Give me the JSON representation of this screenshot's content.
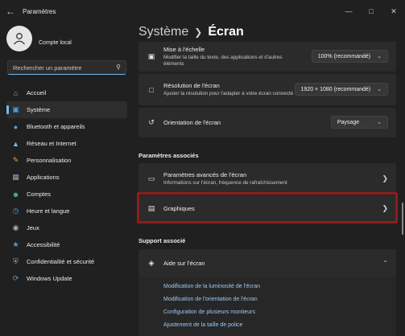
{
  "app": {
    "title": "Paramètres"
  },
  "profile": {
    "name": "Compte local"
  },
  "search": {
    "placeholder": "Rechercher un paramètre"
  },
  "sidebar": {
    "items": [
      {
        "label": "Accueil",
        "icon": "home-icon",
        "color": "#e8a23a"
      },
      {
        "label": "Système",
        "icon": "system-icon",
        "color": "#4aa3e8",
        "active": true
      },
      {
        "label": "Bluetooth et appareils",
        "icon": "bluetooth-icon",
        "color": "#4aa3e8"
      },
      {
        "label": "Réseau et Internet",
        "icon": "wifi-icon",
        "color": "#6fc3ef"
      },
      {
        "label": "Personnalisation",
        "icon": "brush-icon",
        "color": "#e8a23a"
      },
      {
        "label": "Applications",
        "icon": "apps-icon",
        "color": "#9aa4b2"
      },
      {
        "label": "Comptes",
        "icon": "accounts-icon",
        "color": "#3fbf8a"
      },
      {
        "label": "Heure et langue",
        "icon": "globe-clock-icon",
        "color": "#4aa3e8"
      },
      {
        "label": "Jeux",
        "icon": "gamepad-icon",
        "color": "#b0b0b0"
      },
      {
        "label": "Accessibilité",
        "icon": "accessibility-icon",
        "color": "#4aa3e8"
      },
      {
        "label": "Confidentialité et sécurité",
        "icon": "shield-icon",
        "color": "#9aa4b2"
      },
      {
        "label": "Windows Update",
        "icon": "update-icon",
        "color": "#4aa3e8"
      }
    ]
  },
  "breadcrumb": {
    "parent": "Système",
    "current": "Écran"
  },
  "settings": {
    "scale": {
      "title": "Mise à l'échelle",
      "desc": "Modifier la taille du texte, des applications et d'autres éléments",
      "value": "100% (recommandé)"
    },
    "resolution": {
      "title": "Résolution de l'écran",
      "desc": "Ajuster la résolution pour l'adapter à votre écran connecté",
      "value": "1920 × 1080 (recommandé)"
    },
    "orientation": {
      "title": "Orientation de l'écran",
      "value": "Paysage"
    }
  },
  "related": {
    "header": "Paramètres associés",
    "advanced": {
      "title": "Paramètres avancés de l'écran",
      "desc": "Informations sur l'écran, fréquence de rafraîchissement"
    },
    "graphics": {
      "title": "Graphiques"
    }
  },
  "support": {
    "header": "Support associé",
    "help_title": "Aide sur l'écran",
    "links": [
      "Modification de la luminosité de l'écran",
      "Modification de l'orientation de l'écran",
      "Configuration de plusieurs moniteurs",
      "Ajustement de la taille de police"
    ]
  },
  "colors": {
    "accent": "#76b9ed",
    "highlight": "#8f1d1d",
    "background": "#202020",
    "card": "#2b2b2b"
  }
}
